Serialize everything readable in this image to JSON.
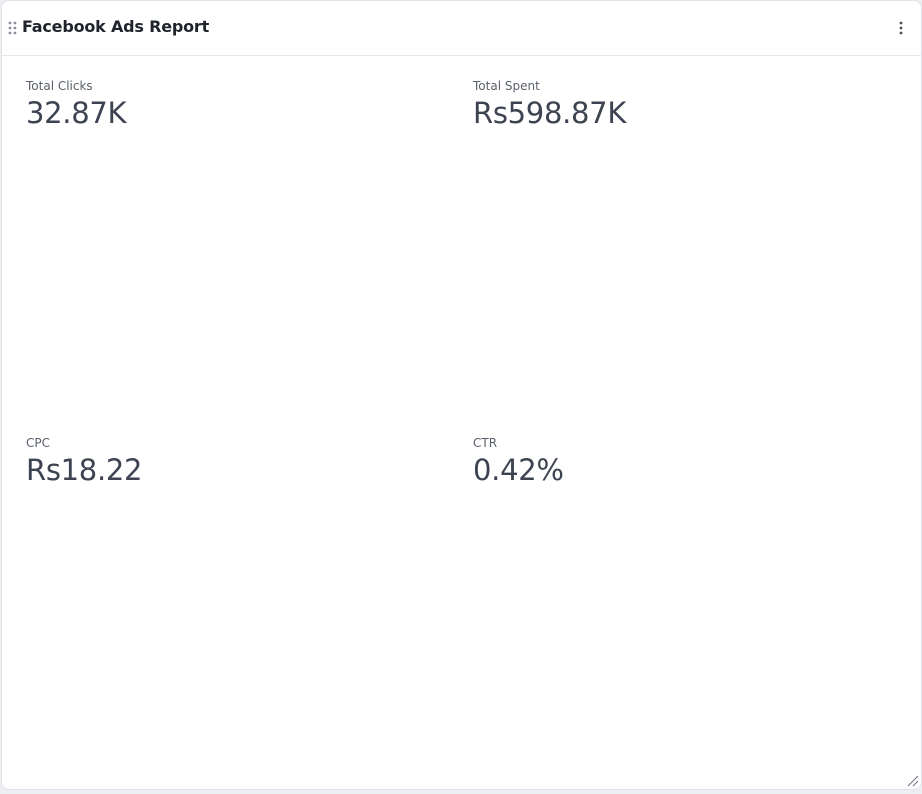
{
  "widget": {
    "title": "Facebook Ads Report",
    "drag_icon": "drag-handle-icon",
    "menu_icon": "more-vertical-icon",
    "resize_icon": "resize-corner-icon"
  },
  "metrics": [
    {
      "label": "Total Clicks",
      "value": "32.87K"
    },
    {
      "label": "Total Spent",
      "value": "Rs598.87K"
    },
    {
      "label": "CPC",
      "value": "Rs18.22"
    },
    {
      "label": "CTR",
      "value": "0.42%"
    }
  ],
  "colors": {
    "background": "#ffffff",
    "title": "#1f232b",
    "label": "#5b616b",
    "value": "#3d4350"
  }
}
